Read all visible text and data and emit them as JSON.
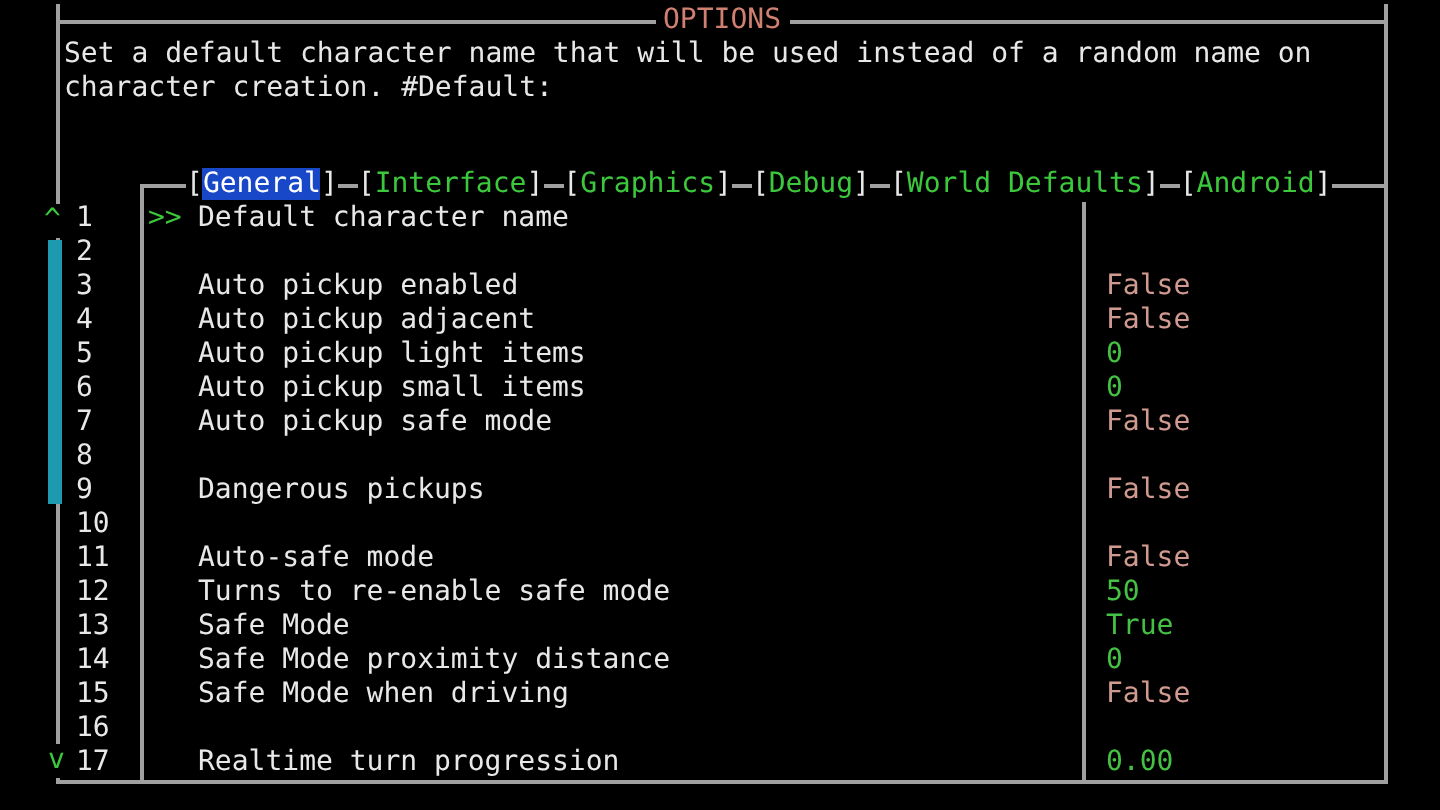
{
  "window": {
    "title": "OPTIONS"
  },
  "description": "Set a default character name that will be used instead of a random name on character creation. #Default:",
  "tab_brackets": [
    "[",
    "]"
  ],
  "tabs": [
    {
      "label": "General",
      "selected": true
    },
    {
      "label": "Interface",
      "selected": false
    },
    {
      "label": "Graphics",
      "selected": false
    },
    {
      "label": "Debug",
      "selected": false
    },
    {
      "label": "World Defaults",
      "selected": false
    },
    {
      "label": "Android",
      "selected": false
    }
  ],
  "scroll_up": "^",
  "scroll_down": "v",
  "cursor": ">>",
  "rows": [
    {
      "kind": "option",
      "num": "1",
      "label": "Default character name",
      "selected": true
    },
    {
      "kind": "blank",
      "num": "2",
      "selected": false
    },
    {
      "kind": "option",
      "num": "3",
      "label": "Auto pickup enabled",
      "value": "False",
      "color": "#d09a90",
      "selected": false
    },
    {
      "kind": "option",
      "num": "4",
      "label": "Auto pickup adjacent",
      "value": "False",
      "color": "#d09a90",
      "selected": false
    },
    {
      "kind": "option",
      "num": "5",
      "label": "Auto pickup light items",
      "value": "0",
      "color": "#44c044",
      "selected": false
    },
    {
      "kind": "option",
      "num": "6",
      "label": "Auto pickup small items",
      "value": "0",
      "color": "#44c044",
      "selected": false
    },
    {
      "kind": "option",
      "num": "7",
      "label": "Auto pickup safe mode",
      "value": "False",
      "color": "#d09a90",
      "selected": false
    },
    {
      "kind": "blank",
      "num": "8",
      "selected": false
    },
    {
      "kind": "option",
      "num": "9",
      "label": "Dangerous pickups",
      "value": "False",
      "color": "#d09a90",
      "selected": false
    },
    {
      "kind": "blank",
      "num": "10",
      "selected": false
    },
    {
      "kind": "option",
      "num": "11",
      "label": "Auto-safe mode",
      "value": "False",
      "color": "#d09a90",
      "selected": false
    },
    {
      "kind": "option",
      "num": "12",
      "label": "Turns to re-enable safe mode",
      "value": "50",
      "color": "#44c044",
      "selected": false
    },
    {
      "kind": "option",
      "num": "13",
      "label": "Safe Mode",
      "value": "True",
      "color": "#44c044",
      "selected": false
    },
    {
      "kind": "option",
      "num": "14",
      "label": "Safe Mode proximity distance",
      "value": "0",
      "color": "#44c044",
      "selected": false
    },
    {
      "kind": "option",
      "num": "15",
      "label": "Safe Mode when driving",
      "value": "False",
      "color": "#d09a90",
      "selected": false
    },
    {
      "kind": "blank",
      "num": "16",
      "selected": false
    },
    {
      "kind": "option",
      "num": "17",
      "label": "Realtime turn progression",
      "value": "0.00",
      "color": "#44c044",
      "selected": false
    }
  ]
}
